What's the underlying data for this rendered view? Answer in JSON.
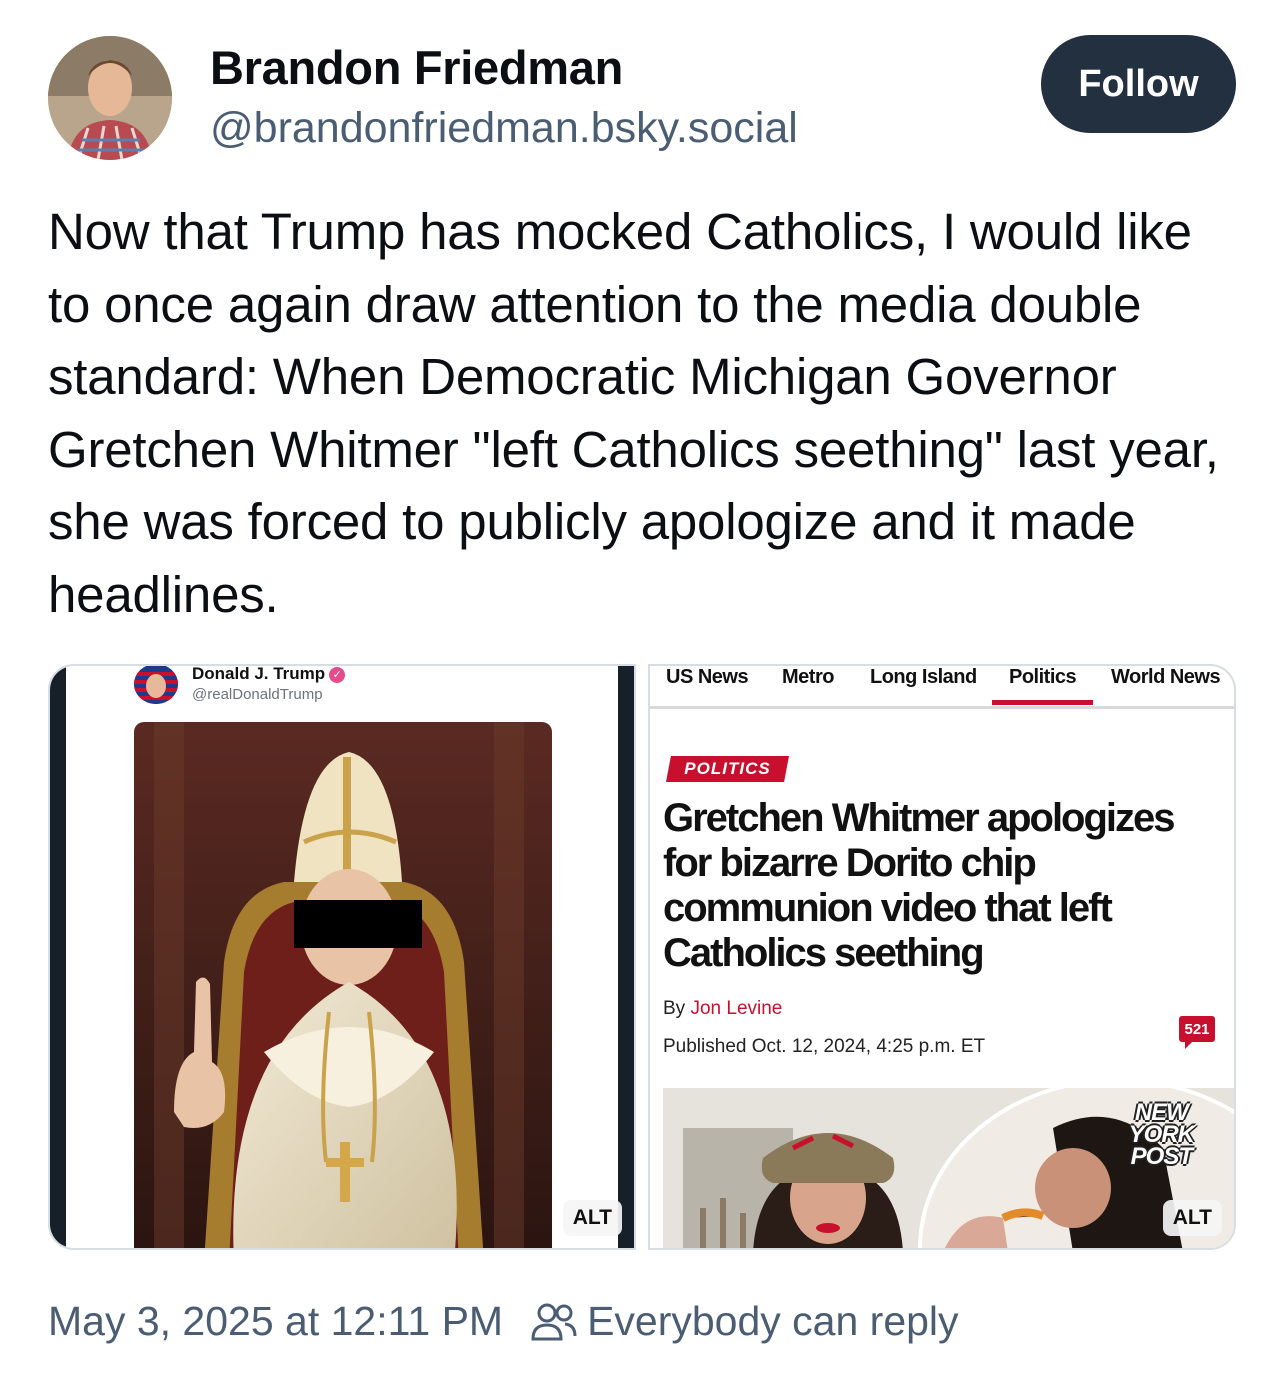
{
  "author": {
    "display_name": "Brandon Friedman",
    "handle": "@brandonfriedman.bsky.social"
  },
  "follow_label": "Follow",
  "post_text": "Now that Trump has mocked Catholics, I would like to once again draw attention to the media double standard: When Democratic Michigan Governor Gretchen Whitmer \"left Catholics seething\" last year, she was forced to publicly apologize and it made headlines.",
  "images": [
    {
      "alt_label": "ALT",
      "embedded_post": {
        "name": "Donald J. Trump",
        "handle": "@realDonaldTrump"
      }
    },
    {
      "alt_label": "ALT",
      "nav": [
        "US News",
        "Metro",
        "Long Island",
        "Politics",
        "World News"
      ],
      "section": "POLITICS",
      "headline": "Gretchen Whitmer apologizes for bizarre Dorito chip communion video that left Catholics seething",
      "by_prefix": "By",
      "author": "Jon Levine",
      "published": "Published Oct. 12, 2024, 4:25 p.m. ET",
      "comment_count": "521",
      "logo_lines": [
        "NEW",
        "YORK",
        "POST"
      ]
    }
  ],
  "footer": {
    "timestamp": "May 3, 2025 at 12:11 PM",
    "reply_setting": "Everybody can reply"
  },
  "colors": {
    "follow_bg": "#233040",
    "muted_text": "#4b5d73",
    "nyp_red": "#c8102e"
  }
}
